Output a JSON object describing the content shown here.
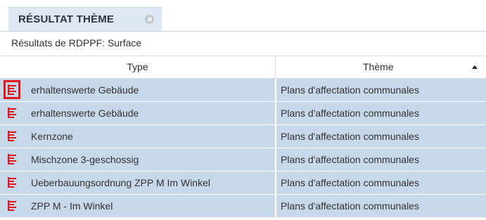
{
  "tab": {
    "title": "RÉSULTAT THÈME"
  },
  "subtitle": "Résultats de RDPPF: Surface",
  "columns": {
    "type": "Type",
    "theme": "Thème"
  },
  "accent_color": "#e0191e",
  "row_color": "#c7d8ea",
  "rows": [
    {
      "type": "erhaltenswerte Gebäude",
      "theme": "Plans d'affectation communales",
      "icon": "legend-list-icon",
      "highlighted": true
    },
    {
      "type": "erhaltenswerte Gebäude",
      "theme": "Plans d'affectation communales",
      "icon": "legend-list-icon"
    },
    {
      "type": "Kernzone",
      "theme": "Plans d'affectation communales",
      "icon": "legend-list-icon"
    },
    {
      "type": "Mischzone 3-geschossig",
      "theme": "Plans d'affectation communales",
      "icon": "legend-list-icon"
    },
    {
      "type": "Ueberbauungsordnung ZPP M Im Winkel",
      "theme": "Plans d'affectation communales",
      "icon": "legend-list-icon"
    },
    {
      "type": "ZPP M - Im Winkel",
      "theme": "Plans d'affectation communales",
      "icon": "legend-list-icon"
    }
  ]
}
